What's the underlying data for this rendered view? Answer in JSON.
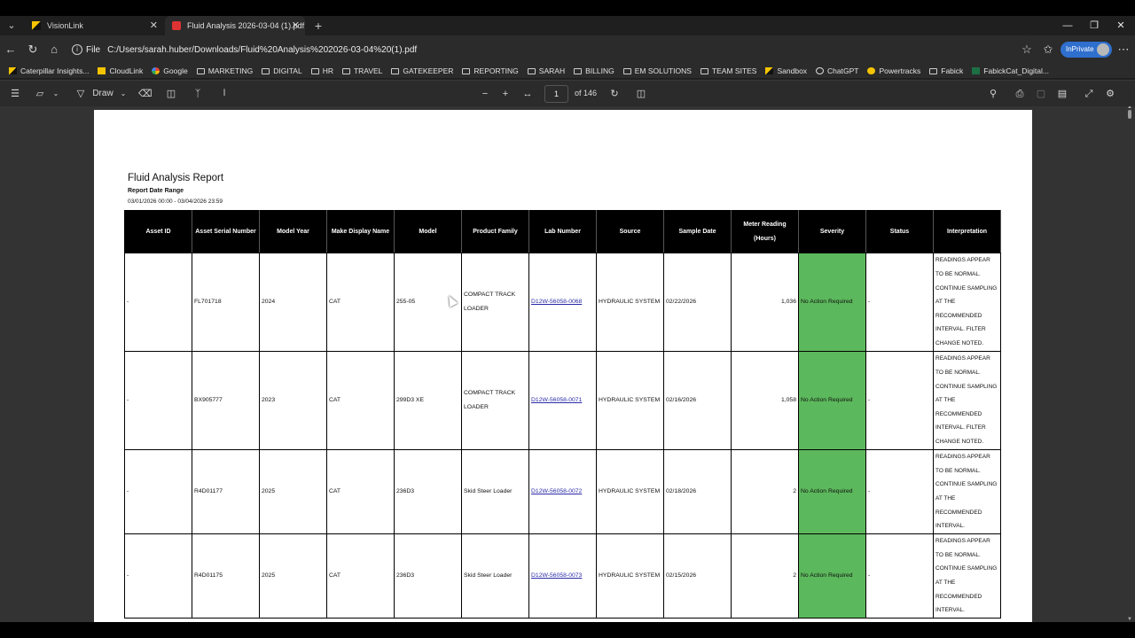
{
  "tabs": [
    {
      "title": "VisionLink",
      "active": false
    },
    {
      "title": "Fluid Analysis 2026-03-04 (1).pdf",
      "active": true
    }
  ],
  "address": {
    "scheme_label": "File",
    "url": "C:/Users/sarah.huber/Downloads/Fluid%20Analysis%202026-03-04%20(1).pdf"
  },
  "profile": {
    "label": "InPrivate"
  },
  "bookmarks": [
    {
      "label": "Caterpillar Insights...",
      "icon": "cat-logo-icon"
    },
    {
      "label": "CloudLink",
      "icon": "cloudlink-icon"
    },
    {
      "label": "Google",
      "icon": "google-icon"
    },
    {
      "label": "MARKETING",
      "icon": "folder-icon"
    },
    {
      "label": "DIGITAL",
      "icon": "folder-icon"
    },
    {
      "label": "HR",
      "icon": "folder-icon"
    },
    {
      "label": "TRAVEL",
      "icon": "folder-icon"
    },
    {
      "label": "GATEKEEPER",
      "icon": "folder-icon"
    },
    {
      "label": "REPORTING",
      "icon": "folder-icon"
    },
    {
      "label": "SARAH",
      "icon": "folder-icon"
    },
    {
      "label": "BILLING",
      "icon": "folder-icon"
    },
    {
      "label": "EM SOLUTIONS",
      "icon": "folder-icon"
    },
    {
      "label": "TEAM SITES",
      "icon": "folder-icon"
    },
    {
      "label": "Sandbox",
      "icon": "cat-logo-icon"
    },
    {
      "label": "ChatGPT",
      "icon": "chatgpt-icon"
    },
    {
      "label": "Powertracks",
      "icon": "powertracks-icon"
    },
    {
      "label": "Fabick",
      "icon": "folder-icon"
    },
    {
      "label": "FabickCat_Digital...",
      "icon": "excel-icon"
    }
  ],
  "pdf_toolbar": {
    "draw_label": "Draw",
    "page_current": "1",
    "page_total": "of 146"
  },
  "report": {
    "title": "Fluid Analysis Report",
    "range_label": "Report Date Range",
    "range_value": "03/01/2026 00:00 - 03/04/2026 23:59",
    "columns": [
      "Asset ID",
      "Asset Serial Number",
      "Model Year",
      "Make Display Name",
      "Model",
      "Product Family",
      "Lab Number",
      "Source",
      "Sample Date",
      "Meter Reading (Hours)",
      "Severity",
      "Status",
      "Interpretation"
    ],
    "rows": [
      {
        "asset_id": "-",
        "serial": "FL701718",
        "year": "2024",
        "make": "CAT",
        "model": "255-05",
        "family": "COMPACT TRACK LOADER",
        "lab": "D12W-56058-0068",
        "source": "HYDRAULIC SYSTEM",
        "date": "02/22/2026",
        "meter": "1,036",
        "severity": "No Action Required",
        "status": "-",
        "interpretation": "READINGS APPEAR TO BE NORMAL. CONTINUE SAMPLING AT THE RECOMMENDED INTERVAL.  FILTER CHANGE NOTED."
      },
      {
        "asset_id": "-",
        "serial": "BX905777",
        "year": "2023",
        "make": "CAT",
        "model": "299D3 XE",
        "family": "COMPACT TRACK LOADER",
        "lab": "D12W-56058-0071",
        "source": "HYDRAULIC SYSTEM",
        "date": "02/16/2026",
        "meter": "1,058",
        "severity": "No Action Required",
        "status": "-",
        "interpretation": "READINGS APPEAR TO BE NORMAL. CONTINUE SAMPLING AT THE RECOMMENDED INTERVAL.  FILTER CHANGE NOTED."
      },
      {
        "asset_id": "-",
        "serial": "R4D01177",
        "year": "2025",
        "make": "CAT",
        "model": "236D3",
        "family": "Skid Steer Loader",
        "lab": "D12W-56058-0072",
        "source": "HYDRAULIC SYSTEM",
        "date": "02/18/2026",
        "meter": "2",
        "severity": "No Action Required",
        "status": "-",
        "interpretation": "READINGS APPEAR TO BE NORMAL. CONTINUE SAMPLING AT THE RECOMMENDED INTERVAL."
      },
      {
        "asset_id": "-",
        "serial": "R4D01175",
        "year": "2025",
        "make": "CAT",
        "model": "236D3",
        "family": "Skid Steer Loader",
        "lab": "D12W-56058-0073",
        "source": "HYDRAULIC SYSTEM",
        "date": "02/15/2026",
        "meter": "2",
        "severity": "No Action Required",
        "status": "-",
        "interpretation": "READINGS APPEAR TO BE NORMAL. CONTINUE SAMPLING AT THE RECOMMENDED INTERVAL."
      }
    ]
  },
  "colors": {
    "severity_ok": "#5cb85c",
    "header_bg": "#000000",
    "inprivate": "#2f6fce"
  }
}
